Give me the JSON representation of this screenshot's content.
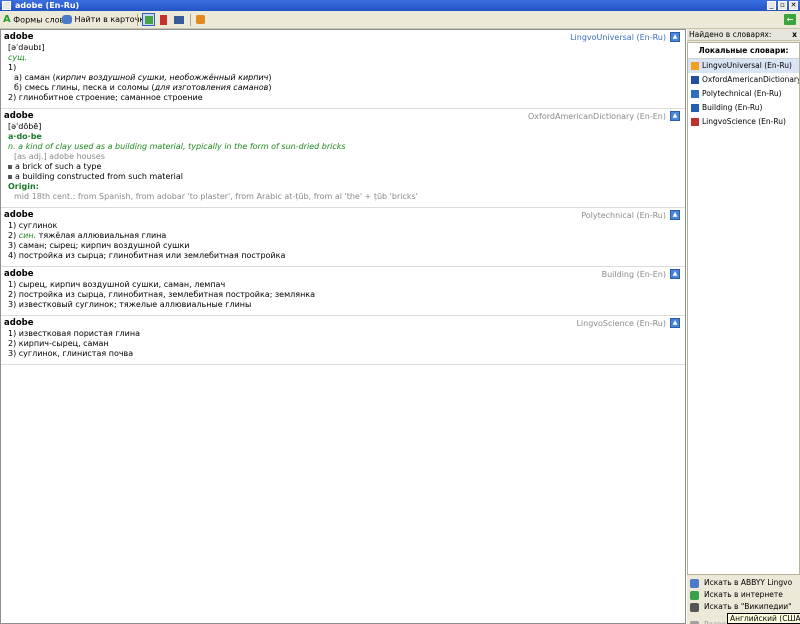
{
  "window": {
    "title": "adobe (En-Ru)",
    "min": "_",
    "max": "▫",
    "close": "✕"
  },
  "toolbar": {
    "word_forms": "Формы слова",
    "find_in_card": "Найти в карточке"
  },
  "entries": [
    {
      "headword": "adobe",
      "dictionary": "LingvoUniversal (En-Ru)",
      "selected": true,
      "lines": [
        {
          "cls": "ind1",
          "text": "[əˈdəubɪ]"
        },
        {
          "cls": "ind1 green",
          "text": "сущ."
        },
        {
          "cls": "ind1",
          "text": "1)"
        },
        {
          "cls": "ind2",
          "parts": [
            "а) саман (",
            "кирпич воздушной сушки, необожжённый кирпич",
            ")"
          ]
        },
        {
          "cls": "ind2",
          "parts": [
            "б) смесь глины, песка и соломы (",
            "для изготовления саманов",
            ")"
          ]
        },
        {
          "cls": "ind1",
          "text": "2) глинобитное строение; саманное строение"
        }
      ]
    },
    {
      "headword": "adobe",
      "dictionary": "OxfordAmericanDictionary (En-En)",
      "lines": [
        {
          "cls": "ind1",
          "text": "[əˈdōbē]"
        },
        {
          "cls": "ind1 green-b",
          "text": "a·do·be"
        },
        {
          "cls": "ind1",
          "parts": [
            "n.",
            " a kind of clay used as a building material, typically in the form of sun-dried bricks"
          ]
        },
        {
          "cls": "ind2 grey",
          "text": "[as adj.] adobe houses"
        },
        {
          "cls": "ind1 bl",
          "text": "a brick of such a type"
        },
        {
          "cls": "ind1 bl",
          "text": "a building constructed from such material"
        },
        {
          "cls": "ind1 green-b",
          "text": "Origin:"
        },
        {
          "cls": "ind2 grey",
          "text": "mid 18th cent.: from Spanish, from adobar 'to plaster', from Arabic at-ṭūb, from al 'the' + ṭūb 'bricks'"
        }
      ]
    },
    {
      "headword": "adobe",
      "dictionary": "Polytechnical (En-Ru)",
      "lines": [
        {
          "cls": "ind1",
          "text": "1) суглинок"
        },
        {
          "cls": "ind1",
          "parts": [
            "2) ",
            "син.",
            " тяжёлая аллювиальная глина"
          ]
        },
        {
          "cls": "ind1",
          "text": "3) саман; сырец; кирпич воздушной сушки"
        },
        {
          "cls": "ind1",
          "text": "4) постройка из сырца; глинобитная или землебитная постройка"
        }
      ]
    },
    {
      "headword": "adobe",
      "dictionary": "Building (En-En)",
      "lines": [
        {
          "cls": "ind1",
          "text": "1) сырец, кирпич воздушной сушки, саман, лемпач"
        },
        {
          "cls": "ind1",
          "text": "2) постройка из сырца, глинобитная, землебитная постройка; землянка"
        },
        {
          "cls": "ind1",
          "text": "3) известковый суглинок; тяжелые аллювиальные глины"
        }
      ]
    },
    {
      "headword": "adobe",
      "dictionary": "LingvoScience (En-Ru)",
      "lines": [
        {
          "cls": "ind1",
          "text": "1) известковая пористая глина"
        },
        {
          "cls": "ind1",
          "text": "2) кирпич-сырец, саман"
        },
        {
          "cls": "ind1",
          "text": "3) суглинок, глинистая почва"
        }
      ]
    }
  ],
  "sidebar": {
    "header": "Найдено в словарях:",
    "close": "x",
    "local_title": "Локальные словари:",
    "dictionaries": [
      {
        "name": "LingvoUniversal (En-Ru)",
        "icon": "book-icon",
        "color": "#f0a020",
        "selected": true
      },
      {
        "name": "OxfordAmericanDictionary (En-En)",
        "icon": "oxford-icon",
        "color": "#2050a0"
      },
      {
        "name": "Polytechnical (En-Ru)",
        "icon": "compass-icon",
        "color": "#3070c0"
      },
      {
        "name": "Building (En-Ru)",
        "icon": "building-icon",
        "color": "#2060b0"
      },
      {
        "name": "LingvoScience (En-Ru)",
        "icon": "shield-icon",
        "color": "#c03030"
      }
    ],
    "links": [
      {
        "label": "Искать в ABBYY Lingvo",
        "icon": "search-icon",
        "disabled": false
      },
      {
        "label": "Искать в интернете",
        "icon": "globe-icon",
        "disabled": false
      },
      {
        "label": "Искать в \"Википедии\"",
        "icon": "wikipedia-icon",
        "disabled": false
      },
      {
        "label": "Развернуть все",
        "icon": "expand-icon",
        "disabled": true
      },
      {
        "label": "Свернуть все",
        "icon": "collapse-icon",
        "disabled": false
      }
    ]
  },
  "tooltip": "Английский (США)",
  "colors": {
    "titlebar": "#2f5fd0",
    "accent": "#3a6fbd",
    "green": "#1e8a1e"
  }
}
